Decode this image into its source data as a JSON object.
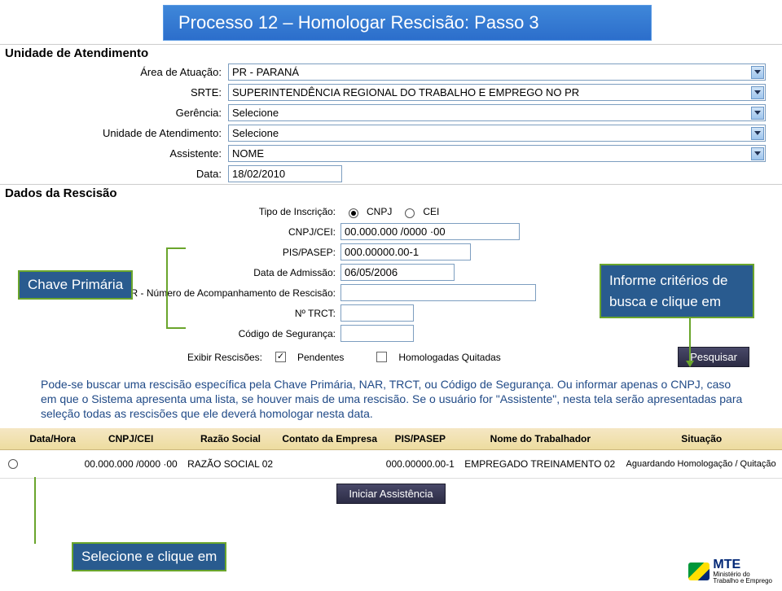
{
  "title": "Processo 12 – Homologar Rescisão: Passo 3",
  "sections": {
    "unidade": "Unidade de Atendimento",
    "dados": "Dados da Rescisão"
  },
  "labels": {
    "area": "Área de Atuação:",
    "srte": "SRTE:",
    "gerencia": "Gerência:",
    "unidade_at": "Unidade de Atendimento:",
    "assistente": "Assistente:",
    "data": "Data:",
    "tipo_inscricao": "Tipo de Inscrição:",
    "cnpj_cei": "CNPJ/CEI:",
    "pis": "PIS/PASEP:",
    "data_adm": "Data de Admissão:",
    "nar": "NAR - Número de Acompanhamento de Rescisão:",
    "trct": "Nº TRCT:",
    "cod_seguranca": "Código de Segurança:",
    "exibir": "Exibir Rescisões:",
    "pendentes": "Pendentes",
    "homolog_quit": "Homologadas Quitadas",
    "pesquisar": "Pesquisar"
  },
  "values": {
    "area": "PR - PARANÁ",
    "srte": "SUPERINTENDÊNCIA REGIONAL DO TRABALHO E EMPREGO NO PR",
    "gerencia": "Selecione",
    "unidade_at": "Selecione",
    "assistente": "NOME",
    "data": "18/02/2010",
    "cnpj_cei": "00.000.000 /0000 ·00",
    "pis": "000.00000.00-1",
    "data_adm": "06/05/2006",
    "nar": "",
    "trct": "",
    "cod_seguranca": "",
    "tipo_opt_cnpj": "CNPJ",
    "tipo_opt_cei": "CEI"
  },
  "callouts": {
    "chave": "Chave Primária",
    "informe": "Informe critérios de busca e clique em",
    "selecione": "Selecione e clique em"
  },
  "helptext": "Pode-se buscar uma rescisão específica pela Chave Primária, NAR, TRCT, ou Código de Segurança. Ou informar apenas o CNPJ, caso em que o Sistema apresenta uma lista, se houver mais de uma rescisão. Se o usuário for \"Assistente\", nesta tela serão apresentadas para seleção todas as rescisões que ele deverá homologar nesta data.",
  "table": {
    "headers": [
      "Data/Hora",
      "CNPJ/CEI",
      "Razão Social",
      "Contato da Empresa",
      "PIS/PASEP",
      "Nome do Trabalhador",
      "Situação"
    ],
    "row": {
      "data_hora": "",
      "cnpj": "00.000.000 /0000 ·00",
      "razao": "RAZÃO SOCIAL 02",
      "contato": "",
      "pis": "000.00000.00-1",
      "nome": "EMPREGADO TREINAMENTO 02",
      "situacao": "Aguardando Homologação / Quitação"
    }
  },
  "buttons": {
    "iniciar": "Iniciar Assistência"
  },
  "footer": {
    "mte": "MTE",
    "sub": "Ministério do\nTrabalho e Emprego"
  }
}
